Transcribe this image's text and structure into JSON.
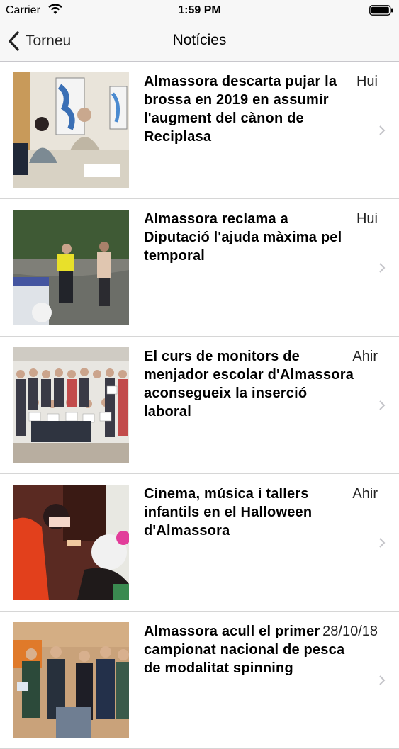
{
  "status_bar": {
    "carrier": "Carrier",
    "time": "1:59 PM",
    "wifi_icon": "wifi-icon",
    "battery_icon": "battery-icon"
  },
  "nav_bar": {
    "back_label": "Torneu",
    "title": "Notícies",
    "back_icon": "chevron-left-icon"
  },
  "news": [
    {
      "headline": "Almassora descarta pujar la brossa en 2019 en assumir l'augment del cànon de Reciplasa",
      "date": "Hui",
      "thumbnail": "meeting-photo"
    },
    {
      "headline": "Almassora reclama a Diputació l'ajuda màxima pel temporal",
      "date": "Hui",
      "thumbnail": "storm-photo"
    },
    {
      "headline": "El curs de monitors de menjador escolar d'Almassora aconsegueix la inserció laboral",
      "date": "Ahir",
      "thumbnail": "group-photo"
    },
    {
      "headline": "Cinema, música i tallers infantils en el Halloween d'Almassora",
      "date": "Ahir",
      "thumbnail": "halloween-photo"
    },
    {
      "headline": "Almassora acull el primer campionat nacional de pesca de modalitat spinning",
      "date": "28/10/18",
      "thumbnail": "fishing-photo"
    }
  ]
}
